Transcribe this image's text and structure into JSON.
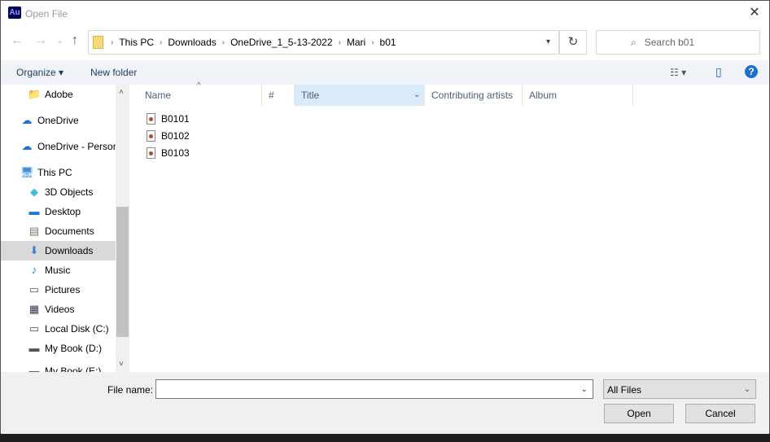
{
  "window": {
    "title": "Open File",
    "app_icon": "Au",
    "close": "✕"
  },
  "nav": {
    "back": "←",
    "forward": "→",
    "recent": "⌄",
    "up": "↑"
  },
  "address": {
    "crumbs": [
      "This PC",
      "Downloads",
      "OneDrive_1_5-13-2022",
      "Mari",
      "b01"
    ],
    "refresh": "↻"
  },
  "search": {
    "placeholder": "Search b01",
    "icon": "⌕"
  },
  "toolbar": {
    "organize": "Organize ▾",
    "new_folder": "New folder",
    "view": "☷ ▾",
    "pane": "▯",
    "help": "?"
  },
  "sidebar": {
    "items": [
      {
        "label": "Adobe",
        "icon": "folder-sync-icon",
        "glyph": "📁",
        "indent": true
      },
      {
        "label": "OneDrive",
        "icon": "cloud-icon",
        "glyph": "☁",
        "indent": false
      },
      {
        "label": "OneDrive - Personal",
        "icon": "cloud-icon",
        "glyph": "☁",
        "indent": false
      },
      {
        "label": "This PC",
        "icon": "computer-icon",
        "glyph": "🖥",
        "indent": false
      },
      {
        "label": "3D Objects",
        "icon": "cube-icon",
        "glyph": "◆",
        "indent": true
      },
      {
        "label": "Desktop",
        "icon": "desktop-icon",
        "glyph": "▬",
        "indent": true
      },
      {
        "label": "Documents",
        "icon": "document-icon",
        "glyph": "▤",
        "indent": true
      },
      {
        "label": "Downloads",
        "icon": "download-icon",
        "glyph": "⬇",
        "indent": true,
        "selected": true
      },
      {
        "label": "Music",
        "icon": "music-icon",
        "glyph": "♪",
        "indent": true
      },
      {
        "label": "Pictures",
        "icon": "pictures-icon",
        "glyph": "▭",
        "indent": true
      },
      {
        "label": "Videos",
        "icon": "videos-icon",
        "glyph": "▦",
        "indent": true
      },
      {
        "label": "Local Disk (C:)",
        "icon": "drive-icon",
        "glyph": "▭",
        "indent": true
      },
      {
        "label": "My Book (D:)",
        "icon": "drive-icon",
        "glyph": "▬",
        "indent": true
      },
      {
        "label": "My Book (E:)",
        "icon": "drive-icon",
        "glyph": "▬",
        "indent": true
      }
    ]
  },
  "columns": [
    {
      "label": "Name"
    },
    {
      "label": "#"
    },
    {
      "label": "Title",
      "active": true
    },
    {
      "label": "Contributing artists"
    },
    {
      "label": "Album"
    }
  ],
  "files": [
    "B0101",
    "B0102",
    "B0103"
  ],
  "bottom": {
    "file_name_label": "File name:",
    "file_name_value": "",
    "file_type": "All Files",
    "open": "Open",
    "cancel": "Cancel"
  }
}
